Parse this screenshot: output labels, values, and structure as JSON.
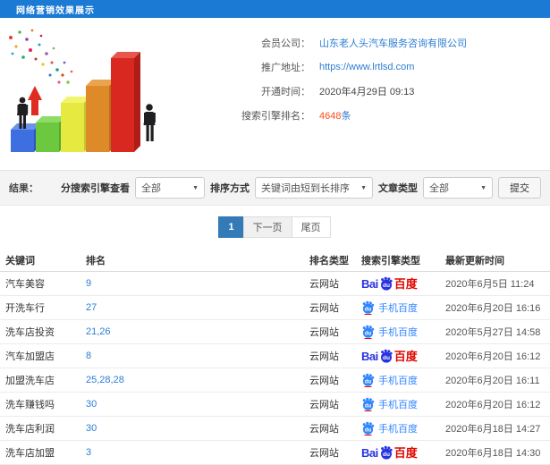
{
  "header": {
    "title": "网络营销效果展示",
    "bg": "#1b7ad3"
  },
  "info": {
    "member_label": "会员公司：",
    "member_value": "山东老人头汽车服务咨询有限公司",
    "url_label": "推广地址：",
    "url_value": "https://www.lrtlsd.com",
    "open_label": "开通时间：",
    "open_value": "2020年4月29日 09:13",
    "rank_label": "搜索引擎排名：",
    "rank_count": "4648",
    "rank_unit": "条"
  },
  "illustration_name": "rising-bar-chart-with-businessmen",
  "filters": {
    "result_label": "结果：",
    "engine_label": "分搜索引擎查看",
    "engine_value": "全部",
    "sort_label": "排序方式",
    "sort_value": "关键词由短到长排序",
    "article_label": "文章类型",
    "article_value": "全部",
    "submit_label": "提交"
  },
  "pagination": {
    "current": "1",
    "next": "下一页",
    "last": "尾页"
  },
  "table": {
    "headers": [
      "关键词",
      "排名",
      "排名类型",
      "搜索引擎类型",
      "最新更新时间"
    ],
    "baidu_logo": {
      "bai": "Bai",
      "du": "du",
      "cn": "百度"
    },
    "mobile_label": "手机百度",
    "rows": [
      {
        "keyword": "汽车美容",
        "rank": "9",
        "rank_type": "云网站",
        "engine": "baidu",
        "time": "2020年6月5日 11:24"
      },
      {
        "keyword": "开洗车行",
        "rank": "27",
        "rank_type": "云网站",
        "engine": "mobile-baidu",
        "time": "2020年6月20日 16:16"
      },
      {
        "keyword": "洗车店投资",
        "rank": "21,26",
        "rank_type": "云网站",
        "engine": "mobile-baidu",
        "time": "2020年5月27日 14:58"
      },
      {
        "keyword": "汽车加盟店",
        "rank": "8",
        "rank_type": "云网站",
        "engine": "baidu",
        "time": "2020年6月20日 16:12"
      },
      {
        "keyword": "加盟洗车店",
        "rank": "25,28,28",
        "rank_type": "云网站",
        "engine": "mobile-baidu",
        "time": "2020年6月20日 16:11"
      },
      {
        "keyword": "洗车赚钱吗",
        "rank": "30",
        "rank_type": "云网站",
        "engine": "mobile-baidu",
        "time": "2020年6月20日 16:12"
      },
      {
        "keyword": "洗车店利润",
        "rank": "30",
        "rank_type": "云网站",
        "engine": "mobile-baidu",
        "time": "2020年6月18日 14:27"
      },
      {
        "keyword": "洗车店加盟",
        "rank": "3",
        "rank_type": "云网站",
        "engine": "baidu",
        "time": "2020年6月18日 14:30"
      }
    ]
  },
  "colors": {
    "header_bg": "#1b7ad3",
    "link": "#2d7dd2",
    "rank_count": "#ff4a1a",
    "pagination_active": "#337ab7",
    "baidu_blue": "#2932e1",
    "baidu_red": "#e10600",
    "mobile_blue": "#3385ff",
    "bars": [
      "#3e6fe0",
      "#6cc93f",
      "#e6e93f",
      "#de8a28",
      "#d8281f"
    ]
  }
}
